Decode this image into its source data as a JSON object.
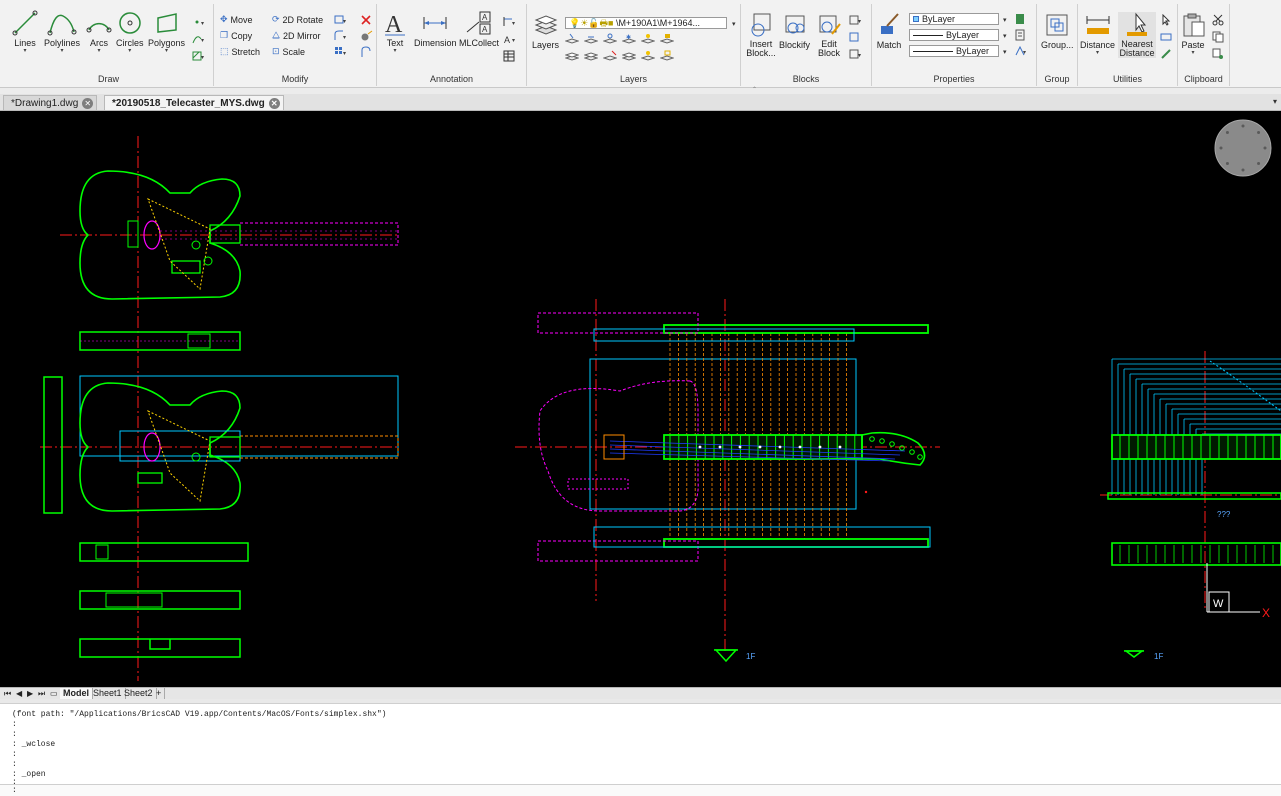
{
  "ribbon": {
    "draw": {
      "title": "Draw",
      "lines": "Lines",
      "polylines": "Polylines",
      "arcs": "Arcs",
      "circles": "Circles",
      "polygons": "Polygons"
    },
    "modify": {
      "title": "Modify",
      "move": "Move",
      "rotate": "2D Rotate",
      "copy": "Copy",
      "mirror": "2D Mirror",
      "stretch": "Stretch",
      "scale": "Scale"
    },
    "annotation": {
      "title": "Annotation",
      "text": "Text",
      "dimension": "Dimension",
      "mlcollect": "MLCollect"
    },
    "layers": {
      "title": "Layers",
      "layers": "Layers",
      "current_layer": "\\M+190A1\\M+1964..."
    },
    "blocks": {
      "title": "Blocks",
      "insert": "Insert Block...",
      "blockify": "Blockify",
      "edit": "Edit Block"
    },
    "properties": {
      "title": "Properties",
      "match": "Match",
      "color": "ByLayer",
      "linetype": "ByLayer",
      "lineweight": "ByLayer"
    },
    "group": {
      "title": "Group",
      "group": "Group..."
    },
    "utilities": {
      "title": "Utilities",
      "distance": "Distance",
      "nearest": "Nearest Distance"
    },
    "clipboard": {
      "title": "Clipboard",
      "paste": "Paste"
    }
  },
  "tabs": [
    {
      "label": "*Drawing1.dwg"
    },
    {
      "label": "*20190518_Telecaster_MYS.dwg"
    }
  ],
  "canvas": {
    "note_unknown": "???",
    "view_marker_1": "1F",
    "view_marker_2": "1F",
    "ucs_w": "W",
    "ucs_x": "X",
    "colors": {
      "green": "#00ff00",
      "magenta": "#ff00ff",
      "cyan": "#00c8ff",
      "red": "#ff1a1a",
      "yellow": "#ffd400",
      "orange": "#ff8c00",
      "blue": "#1f3cff",
      "white": "#ffffff"
    }
  },
  "layouts": [
    {
      "label": "Model"
    },
    {
      "label": "Sheet1"
    },
    {
      "label": "Sheet2"
    },
    {
      "label": "+"
    }
  ],
  "command": {
    "history": [
      "(font path: \"/Applications/BricsCAD V19.app/Contents/MacOS/Fonts/simplex.shx\")",
      ":",
      ":",
      ": _wclose",
      ":",
      ":",
      ": _open",
      ":"
    ],
    "prompt": ":"
  }
}
